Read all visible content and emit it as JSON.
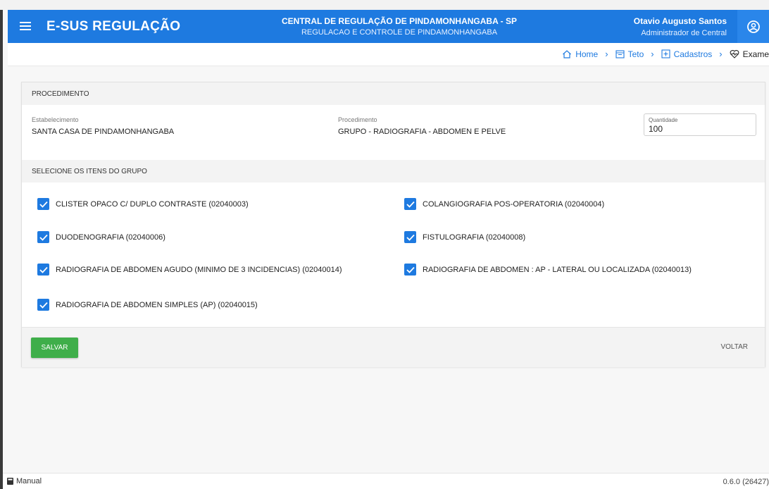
{
  "header": {
    "app_title": "E-SUS REGULAÇÃO",
    "central_title": "CENTRAL DE REGULAÇÃO DE PINDAMONHANGABA - SP",
    "central_subtitle": "REGULACAO E CONTROLE DE PINDAMONHANGABA",
    "user_name": "Otavio Augusto Santos",
    "user_role": "Administrador de Central",
    "menu_icon": "hamburger-menu-icon",
    "user_icon": "user-circle-icon"
  },
  "breadcrumb": {
    "items": [
      {
        "label": "Home",
        "icon": "home-icon"
      },
      {
        "label": "Teto",
        "icon": "calendar-icon"
      },
      {
        "label": "Cadastros",
        "icon": "plus-box-icon"
      },
      {
        "label": "Exame",
        "icon": "heart-pulse-icon"
      }
    ]
  },
  "form": {
    "section_procedimento": "PROCEDIMENTO",
    "estabelecimento_label": "Estabelecimento",
    "estabelecimento_value": "SANTA CASA DE PINDAMONHANGABA",
    "procedimento_label": "Procedimento",
    "procedimento_value": "GRUPO - RADIOGRAFIA - ABDOMEN E PELVE",
    "quantidade_label": "Quantidade",
    "quantidade_value": "100",
    "section_itens": "SELECIONE OS ITENS DO GRUPO",
    "items": [
      {
        "label": "CLISTER OPACO C/ DUPLO CONTRASTE (02040003)",
        "checked": true
      },
      {
        "label": "COLANGIOGRAFIA POS-OPERATORIA (02040004)",
        "checked": true
      },
      {
        "label": "DUODENOGRAFIA (02040006)",
        "checked": true
      },
      {
        "label": "FISTULOGRAFIA (02040008)",
        "checked": true
      },
      {
        "label": "RADIOGRAFIA DE ABDOMEN AGUDO (MINIMO DE 3 INCIDENCIAS) (02040014)",
        "checked": true
      },
      {
        "label": "RADIOGRAFIA DE ABDOMEN : AP - LATERAL OU LOCALIZADA (02040013)",
        "checked": true
      },
      {
        "label": "RADIOGRAFIA DE ABDOMEN SIMPLES (AP) (02040015)",
        "checked": true
      }
    ],
    "save_label": "SALVAR",
    "back_label": "VOLTAR"
  },
  "footer": {
    "manual_label": "Manual",
    "version": "0.6.0 (26427)"
  },
  "colors": {
    "primary": "#1e7ae0",
    "success": "#3fae4a"
  }
}
